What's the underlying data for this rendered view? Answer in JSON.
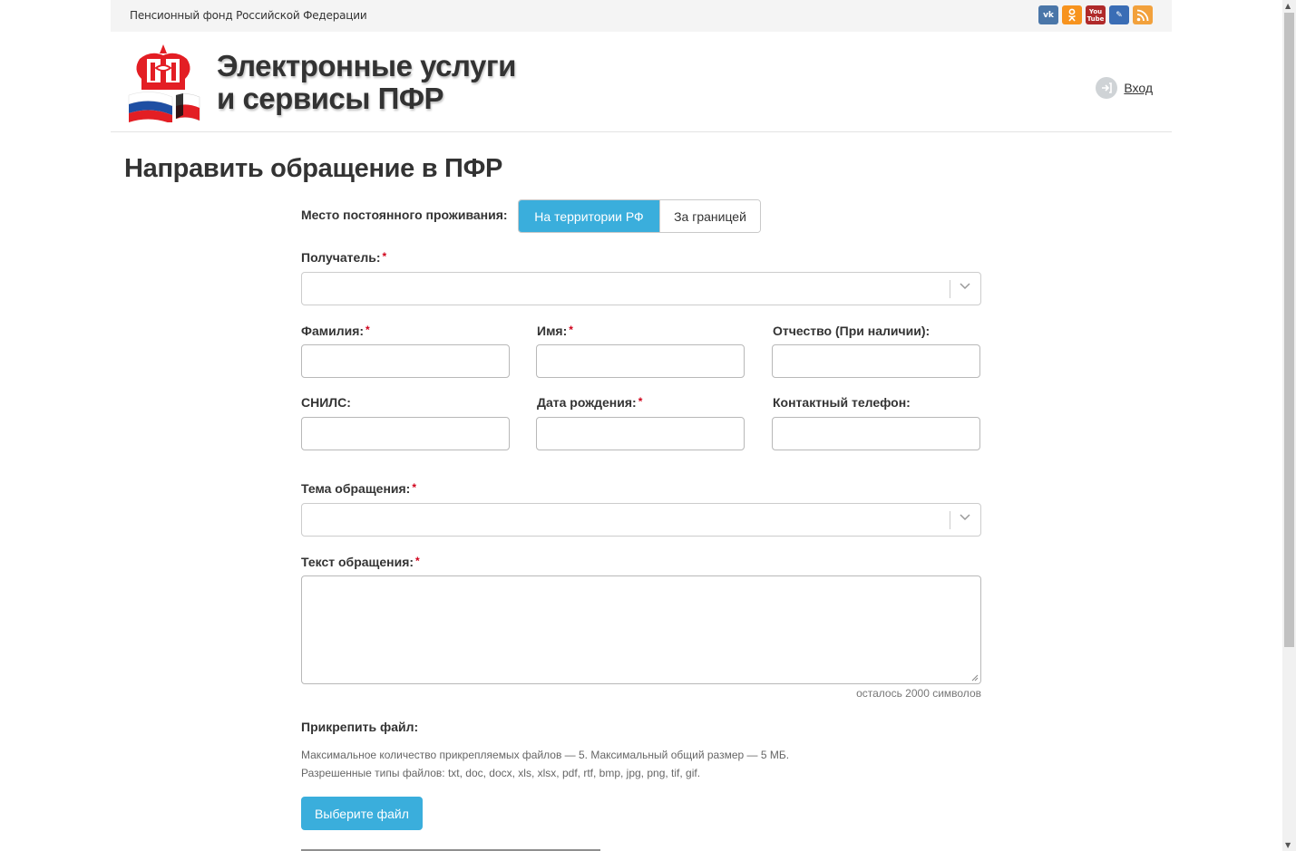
{
  "topbar": {
    "org_name": "Пенсионный фонд Российской Федерации",
    "social": [
      {
        "name": "vk-icon",
        "glyph": "vk"
      },
      {
        "name": "odnoklassniki-icon",
        "glyph": "ok"
      },
      {
        "name": "youtube-icon",
        "glyph": "You Tube"
      },
      {
        "name": "livejournal-icon",
        "glyph": "✎"
      },
      {
        "name": "rss-icon",
        "glyph": ")))"
      }
    ]
  },
  "header": {
    "brand_line1": "Электронные услуги",
    "brand_line2": "и сервисы ПФР",
    "login_label": "Вход"
  },
  "page": {
    "title": "Направить обращение в ПФР"
  },
  "form": {
    "residence_label": "Место постоянного проживания:",
    "residence_options": [
      "На территории РФ",
      "За границей"
    ],
    "residence_selected": "На территории РФ",
    "recipient_label": "Получатель:",
    "surname_label": "Фамилия:",
    "name_label": "Имя:",
    "patronymic_label": "Отчество (При наличии):",
    "snils_label": "СНИЛС:",
    "birthdate_label": "Дата рождения:",
    "phone_label": "Контактный телефон:",
    "topic_label": "Тема обращения:",
    "text_label": "Текст обращения:",
    "chars_left": "осталось 2000 символов",
    "attach_label": "Прикрепить файл:",
    "attach_hint1": "Максимальное количество прикрепляемых файлов — 5. Максимальный общий размер — 5 МБ.",
    "attach_hint2": "Разрешенные типы файлов: txt, doc, docx, xls, xlsx, pdf, rtf, bmp, jpg, png, tif, gif.",
    "choose_file": "Выберите файл",
    "required_mark": "*"
  },
  "colors": {
    "accent": "#3aaedc",
    "required": "#d0021b"
  }
}
